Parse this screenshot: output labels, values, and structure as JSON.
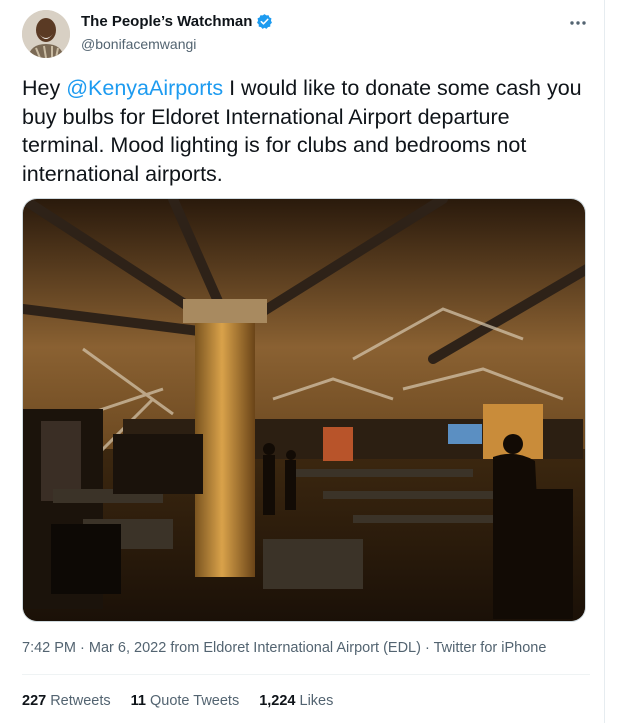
{
  "author": {
    "display_name": "The People’s Watchman",
    "handle": "@bonifacemwangi",
    "verified": true,
    "verified_color": "#1d9bf0"
  },
  "menu": {
    "more_icon": "more-horizontal-icon"
  },
  "tweet": {
    "text_before_mention": "Hey ",
    "mention": "@KenyaAirports",
    "text_after_mention": " I would like to donate some cash you buy bulbs for Eldoret International Airport departure terminal. Mood lighting is for clubs and bedrooms not international airports."
  },
  "meta": {
    "time": "7:42 PM",
    "date": "Mar 6, 2022",
    "location": "from Eldoret International Airport (EDL)",
    "source": "Twitter for iPhone",
    "separator": " · "
  },
  "stats": {
    "retweets_count": "227",
    "retweets_label": "Retweets",
    "quotes_count": "11",
    "quotes_label": "Quote Tweets",
    "likes_count": "1,224",
    "likes_label": "Likes"
  },
  "colors": {
    "accent": "#1d9bf0",
    "text_primary": "#0f1419",
    "text_secondary": "#536471"
  }
}
